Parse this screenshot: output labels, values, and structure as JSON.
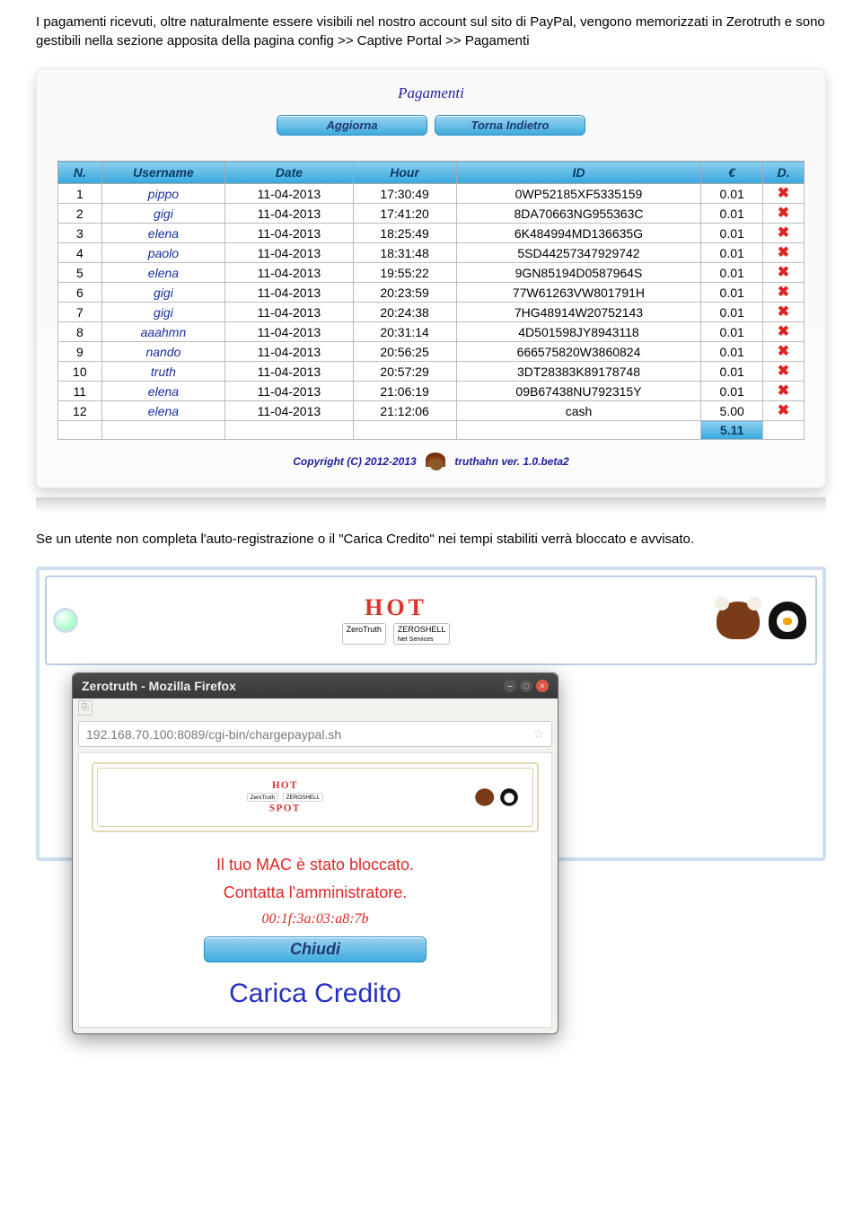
{
  "intro_text": "I pagamenti ricevuti, oltre naturalmente essere visibili nel nostro account sul sito di PayPal, vengono memorizzati in Zerotruth e sono gestibili nella sezione apposita della pagina config >> Captive Portal >> Pagamenti",
  "pagamenti": {
    "title": "Pagamenti",
    "btn_aggiorna": "Aggiorna",
    "btn_indietro": "Torna Indietro",
    "headers": {
      "n": "N.",
      "user": "Username",
      "date": "Date",
      "hour": "Hour",
      "id": "ID",
      "eur": "€",
      "d": "D."
    },
    "rows": [
      {
        "n": "1",
        "user": "pippo",
        "date": "11-04-2013",
        "hour": "17:30:49",
        "id": "0WP52185XF5335159",
        "eur": "0.01"
      },
      {
        "n": "2",
        "user": "gigi",
        "date": "11-04-2013",
        "hour": "17:41:20",
        "id": "8DA70663NG955363C",
        "eur": "0.01"
      },
      {
        "n": "3",
        "user": "elena",
        "date": "11-04-2013",
        "hour": "18:25:49",
        "id": "6K484994MD136635G",
        "eur": "0.01"
      },
      {
        "n": "4",
        "user": "paolo",
        "date": "11-04-2013",
        "hour": "18:31:48",
        "id": "5SD44257347929742",
        "eur": "0.01"
      },
      {
        "n": "5",
        "user": "elena",
        "date": "11-04-2013",
        "hour": "19:55:22",
        "id": "9GN85194D0587964S",
        "eur": "0.01"
      },
      {
        "n": "6",
        "user": "gigi",
        "date": "11-04-2013",
        "hour": "20:23:59",
        "id": "77W61263VW801791H",
        "eur": "0.01"
      },
      {
        "n": "7",
        "user": "gigi",
        "date": "11-04-2013",
        "hour": "20:24:38",
        "id": "7HG48914W20752143",
        "eur": "0.01"
      },
      {
        "n": "8",
        "user": "aaahmn",
        "date": "11-04-2013",
        "hour": "20:31:14",
        "id": "4D501598JY8943118",
        "eur": "0.01"
      },
      {
        "n": "9",
        "user": "nando",
        "date": "11-04-2013",
        "hour": "20:56:25",
        "id": "666575820W3860824",
        "eur": "0.01"
      },
      {
        "n": "10",
        "user": "truth",
        "date": "11-04-2013",
        "hour": "20:57:29",
        "id": "3DT28383K89178748",
        "eur": "0.01"
      },
      {
        "n": "11",
        "user": "elena",
        "date": "11-04-2013",
        "hour": "21:06:19",
        "id": "09B67438NU792315Y",
        "eur": "0.01"
      },
      {
        "n": "12",
        "user": "elena",
        "date": "11-04-2013",
        "hour": "21:12:06",
        "id": "cash",
        "eur": "5.00"
      }
    ],
    "total": "5.11"
  },
  "copyright": "Copyright (C) 2012-2013",
  "version": "truthahn ver. 1.0.beta2",
  "mid_text": "Se un utente non completa l'auto-registrazione o il \"Carica Credito\" nei tempi stabiliti verrà bloccato e avvisato.",
  "hot_top": "HOT",
  "hot_bot": "SPOT",
  "brand1": "ZeroTruth",
  "brand2": "ZEROSHELL",
  "brand2_sub": "Net Services",
  "firefox": {
    "title": "Zerotruth - Mozilla Firefox",
    "url": "192.168.70.100:8089/cgi-bin/chargepaypal.sh",
    "msg1": "Il tuo MAC è stato bloccato.",
    "msg2": "Contatta l'amministratore.",
    "mac": "00:1f:3a:03:a8:7b",
    "btn_close": "Chiudi",
    "credit_link": "Carica Credito"
  }
}
